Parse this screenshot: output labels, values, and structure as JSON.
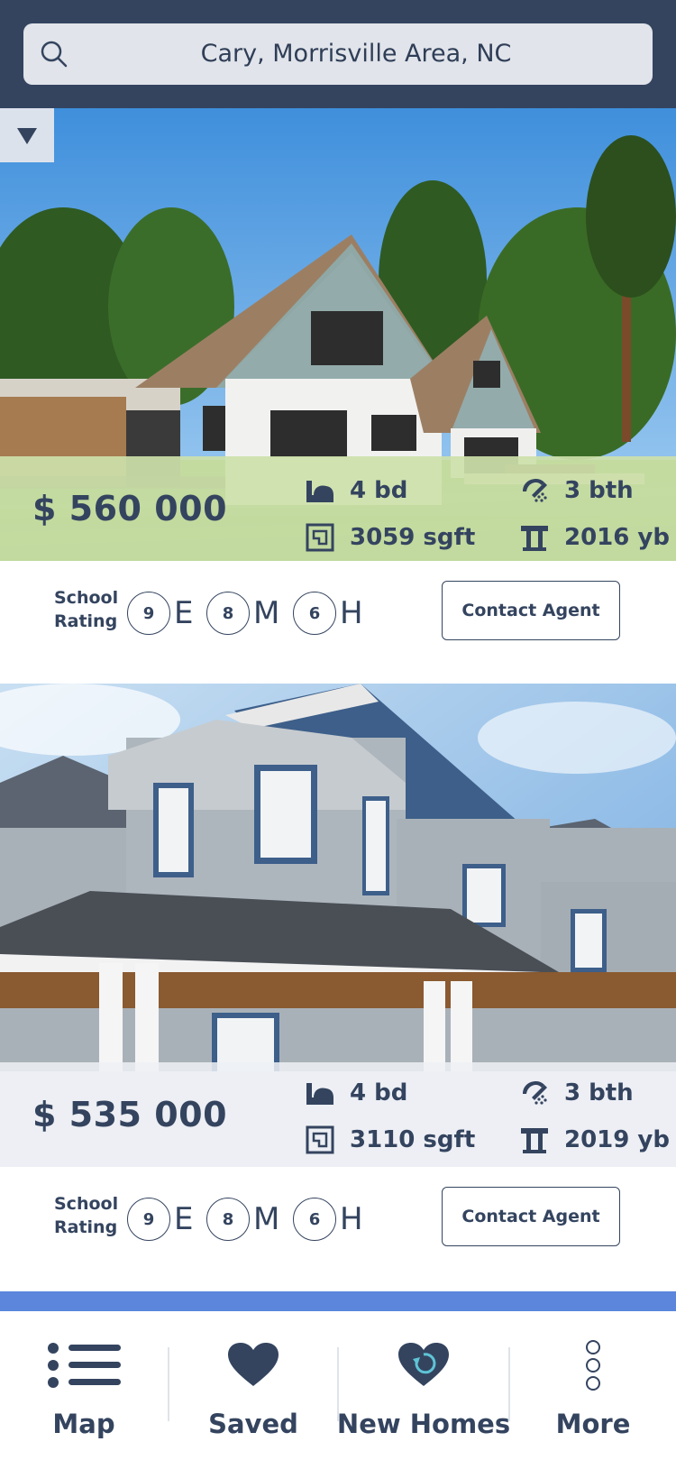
{
  "search": {
    "query": "Cary, Morrisville Area, NC",
    "icon": "search-icon"
  },
  "dropdown": {
    "icon": "triangle-down-icon"
  },
  "listings": [
    {
      "price": "$ 560 000",
      "beds": "4 bd",
      "baths": "3 bth",
      "sqft": "3059 sgft",
      "year": "2016 yb",
      "school_label_1": "School",
      "school_label_2": "Rating",
      "ratings": [
        {
          "score": "9",
          "level": "E"
        },
        {
          "score": "8",
          "level": "M"
        },
        {
          "score": "6",
          "level": "H"
        }
      ],
      "contact_label": "Contact Agent"
    },
    {
      "price": "$ 535 000",
      "beds": "4 bd",
      "baths": "3 bth",
      "sqft": "3110 sgft",
      "year": "2019 yb",
      "school_label_1": "School",
      "school_label_2": "Rating",
      "ratings": [
        {
          "score": "9",
          "level": "E"
        },
        {
          "score": "8",
          "level": "M"
        },
        {
          "score": "6",
          "level": "H"
        }
      ],
      "contact_label": "Contact Agent"
    }
  ],
  "nav": [
    {
      "label": "Map",
      "icon": "list-icon"
    },
    {
      "label": "Saved",
      "icon": "heart-icon"
    },
    {
      "label": "New Homes",
      "icon": "heart-refresh-icon"
    },
    {
      "label": "More",
      "icon": "more-vertical-icon"
    }
  ],
  "colors": {
    "header": "#34445f",
    "accent": "#5b86dc",
    "text": "#34445f",
    "stats_green": "#cde1aa"
  }
}
